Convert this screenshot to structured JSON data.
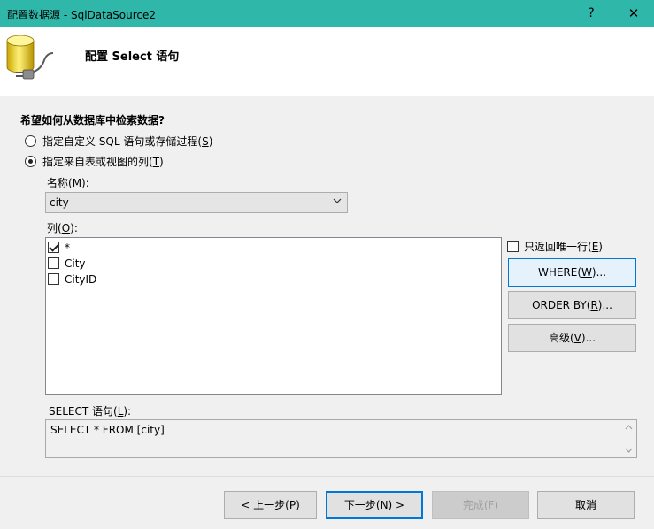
{
  "window": {
    "title": "配置数据源 - SqlDataSource2",
    "help_glyph": "?",
    "close_glyph": "✕"
  },
  "header": {
    "title": "配置 Select 语句",
    "icon": "database-plug-icon"
  },
  "question": "希望如何从数据库中检索数据?",
  "options": {
    "custom_sql": {
      "text": "指定自定义 SQL 语句或存储过程(",
      "key": "S",
      "end": ")",
      "selected": false
    },
    "table_cols": {
      "text": "指定来自表或视图的列(",
      "key": "T",
      "end": ")",
      "selected": true
    }
  },
  "name_label": {
    "text": "名称(",
    "key": "M",
    "end": "):"
  },
  "name_value": "city",
  "columns_label": {
    "text": "列(",
    "key": "O",
    "end": "):"
  },
  "columns": [
    {
      "label": "*",
      "checked": true
    },
    {
      "label": "City",
      "checked": false
    },
    {
      "label": "CityID",
      "checked": false
    }
  ],
  "unique_rows": {
    "text": "只返回唯一行(",
    "key": "E",
    "end": ")",
    "checked": false
  },
  "side_buttons": {
    "where": {
      "text": "WHERE(",
      "key": "W",
      "end": ")..."
    },
    "orderby": {
      "text": "ORDER BY(",
      "key": "R",
      "end": ")..."
    },
    "advanced": {
      "text": "高级(",
      "key": "V",
      "end": ")..."
    }
  },
  "sql_label": {
    "text": "SELECT 语句(",
    "key": "L",
    "end": "):"
  },
  "sql_text": "SELECT * FROM [city]",
  "footer_buttons": {
    "prev": {
      "text": "< 上一步(",
      "key": "P",
      "end": ")"
    },
    "next": {
      "text": "下一步(",
      "key": "N",
      "end": ") >"
    },
    "finish": {
      "text": "完成(",
      "key": "F",
      "end": ")"
    },
    "cancel": "取消"
  },
  "colors": {
    "titlebar": "#2fb7a9",
    "accent": "#0078d7"
  }
}
